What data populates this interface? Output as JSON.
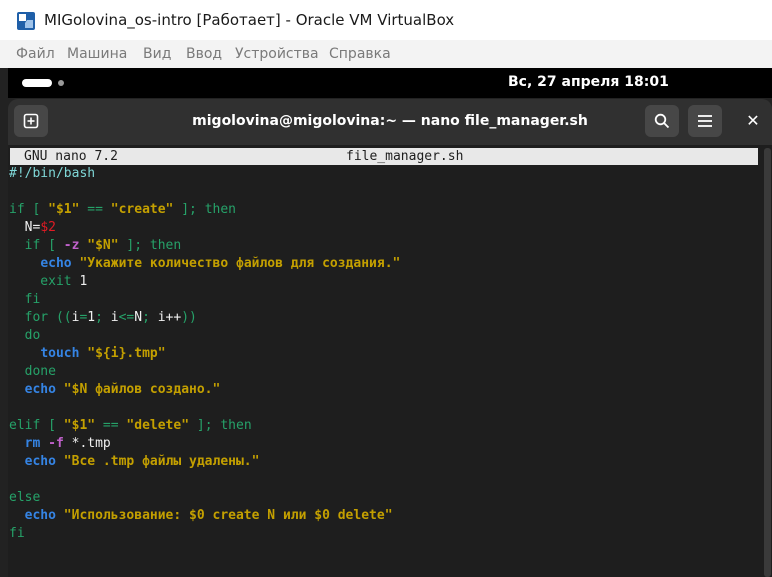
{
  "window": {
    "title": "MIGolovina_os-intro [Работает] - Oracle VM VirtualBox",
    "icon": "virtualbox-icon"
  },
  "menubar": {
    "items": [
      "Файл",
      "Машина",
      "Вид",
      "Ввод",
      "Устройства",
      "Справка"
    ]
  },
  "gnome": {
    "clock": "Вс, 27 апреля  18:01"
  },
  "terminal": {
    "title": "migolovina@migolovina:~ — nano file_manager.sh",
    "new_tab_icon": "new-tab-icon",
    "search_icon": "search-icon",
    "menu_icon": "hamburger-menu-icon",
    "close_label": "✕"
  },
  "nano": {
    "version": "GNU nano 7.2",
    "filename": "file_manager.sh"
  },
  "code_lines": [
    [
      {
        "t": "#!/bin/bash",
        "c": "com"
      }
    ],
    [],
    [
      {
        "t": "if [ ",
        "c": "kw"
      },
      {
        "t": "\"$1\"",
        "c": "str"
      },
      {
        "t": " == ",
        "c": "kw"
      },
      {
        "t": "\"create\"",
        "c": "str"
      },
      {
        "t": " ]; then",
        "c": "kw"
      }
    ],
    [
      {
        "t": "  N=",
        "c": "tx"
      },
      {
        "t": "$2",
        "c": "var"
      }
    ],
    [
      {
        "t": "  if [ ",
        "c": "kw"
      },
      {
        "t": "-z",
        "c": "op"
      },
      {
        "t": " ",
        "c": "tx"
      },
      {
        "t": "\"$N\"",
        "c": "str"
      },
      {
        "t": " ]; then",
        "c": "kw"
      }
    ],
    [
      {
        "t": "    ",
        "c": "tx"
      },
      {
        "t": "echo",
        "c": "cmd"
      },
      {
        "t": " ",
        "c": "tx"
      },
      {
        "t": "\"Укажите количество файлов для создания.\"",
        "c": "str"
      }
    ],
    [
      {
        "t": "    exit",
        "c": "kw"
      },
      {
        "t": " 1",
        "c": "tx"
      }
    ],
    [
      {
        "t": "  fi",
        "c": "kw"
      }
    ],
    [
      {
        "t": "  for ((",
        "c": "kw"
      },
      {
        "t": "i",
        "c": "tx"
      },
      {
        "t": "=",
        "c": "kw"
      },
      {
        "t": "1",
        "c": "tx"
      },
      {
        "t": "; ",
        "c": "kw"
      },
      {
        "t": "i",
        "c": "tx"
      },
      {
        "t": "<=",
        "c": "kw"
      },
      {
        "t": "N",
        "c": "tx"
      },
      {
        "t": "; ",
        "c": "kw"
      },
      {
        "t": "i++",
        "c": "tx"
      },
      {
        "t": "))",
        "c": "kw"
      }
    ],
    [
      {
        "t": "  do",
        "c": "kw"
      }
    ],
    [
      {
        "t": "    ",
        "c": "tx"
      },
      {
        "t": "touch",
        "c": "cmd"
      },
      {
        "t": " ",
        "c": "tx"
      },
      {
        "t": "\"${i}.tmp\"",
        "c": "str"
      }
    ],
    [
      {
        "t": "  done",
        "c": "kw"
      }
    ],
    [
      {
        "t": "  ",
        "c": "tx"
      },
      {
        "t": "echo",
        "c": "cmd"
      },
      {
        "t": " ",
        "c": "tx"
      },
      {
        "t": "\"$N файлов создано.\"",
        "c": "str"
      }
    ],
    [],
    [
      {
        "t": "elif [ ",
        "c": "kw"
      },
      {
        "t": "\"$1\"",
        "c": "str"
      },
      {
        "t": " == ",
        "c": "kw"
      },
      {
        "t": "\"delete\"",
        "c": "str"
      },
      {
        "t": " ]; then",
        "c": "kw"
      }
    ],
    [
      {
        "t": "  ",
        "c": "tx"
      },
      {
        "t": "rm",
        "c": "cmd"
      },
      {
        "t": " ",
        "c": "tx"
      },
      {
        "t": "-f",
        "c": "op"
      },
      {
        "t": " *.tmp",
        "c": "tx"
      }
    ],
    [
      {
        "t": "  ",
        "c": "tx"
      },
      {
        "t": "echo",
        "c": "cmd"
      },
      {
        "t": " ",
        "c": "tx"
      },
      {
        "t": "\"Все .tmp файлы удалены.\"",
        "c": "str"
      }
    ],
    [],
    [
      {
        "t": "else",
        "c": "kw"
      }
    ],
    [
      {
        "t": "  ",
        "c": "tx"
      },
      {
        "t": "echo",
        "c": "cmd"
      },
      {
        "t": " ",
        "c": "tx"
      },
      {
        "t": "\"Использование: $0 create N или $0 delete\"",
        "c": "str"
      }
    ],
    [
      {
        "t": "fi",
        "c": "kw"
      }
    ]
  ],
  "colors": {
    "terminal_bg": "#1e1e1e",
    "header_bg": "#303030",
    "keyword": "#26a269",
    "string": "#c4a000",
    "command": "#3584e4",
    "variable": "#e01b24",
    "comment": "#7fd7d7"
  }
}
